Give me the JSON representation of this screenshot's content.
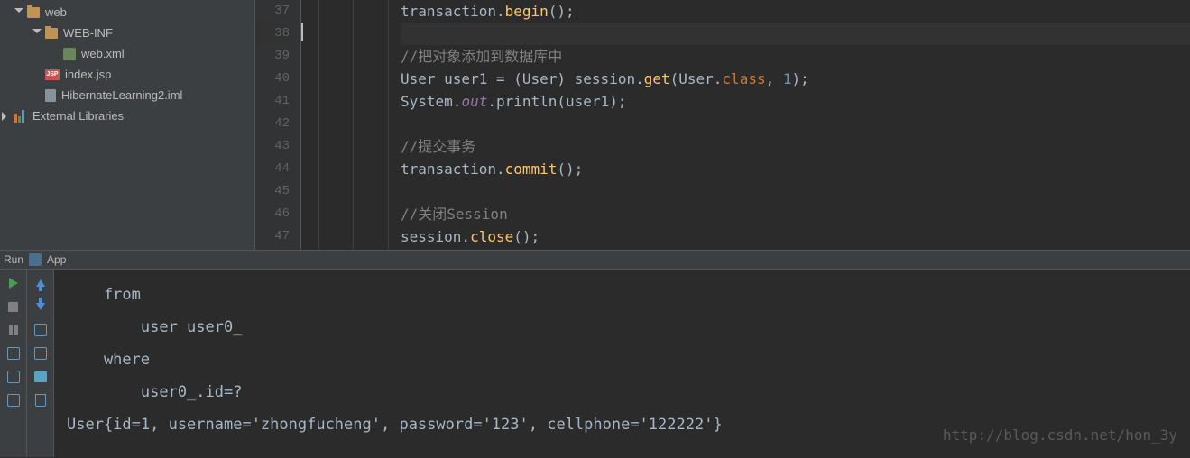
{
  "tree": {
    "web": "web",
    "webinf": "WEB-INF",
    "webxml": "web.xml",
    "indexjsp": "index.jsp",
    "iml": "HibernateLearning2.iml",
    "extlib": "External Libraries"
  },
  "gutter": {
    "l37": "37",
    "l38": "38",
    "l39": "39",
    "l40": "40",
    "l41": "41",
    "l42": "42",
    "l43": "43",
    "l44": "44",
    "l45": "45",
    "l46": "46",
    "l47": "47"
  },
  "code": {
    "l37a": "transaction.",
    "l37b": "begin",
    "l37c": "();",
    "l39": "//把对象添加到数据库中",
    "l40a": "User user1 = (User) session.",
    "l40b": "get",
    "l40c": "(User.",
    "l40d": "class",
    "l40e": ", ",
    "l40f": "1",
    "l40g": ");",
    "l41a": "System.",
    "l41b": "out",
    "l41c": ".println(user1);",
    "l43": "//提交事务",
    "l44a": "transaction.",
    "l44b": "commit",
    "l44c": "();",
    "l46": "//关闭Session",
    "l47a": "session.",
    "l47b": "close",
    "l47c": "();"
  },
  "run": {
    "label": "Run",
    "app": "App"
  },
  "console": {
    "l1": "    from",
    "l2": "        user user0_ ",
    "l3": "    where",
    "l4": "        user0_.id=?",
    "l5": "User{id=1, username='zhongfucheng', password='123', cellphone='122222'}"
  },
  "watermark": "http://blog.csdn.net/hon_3y"
}
